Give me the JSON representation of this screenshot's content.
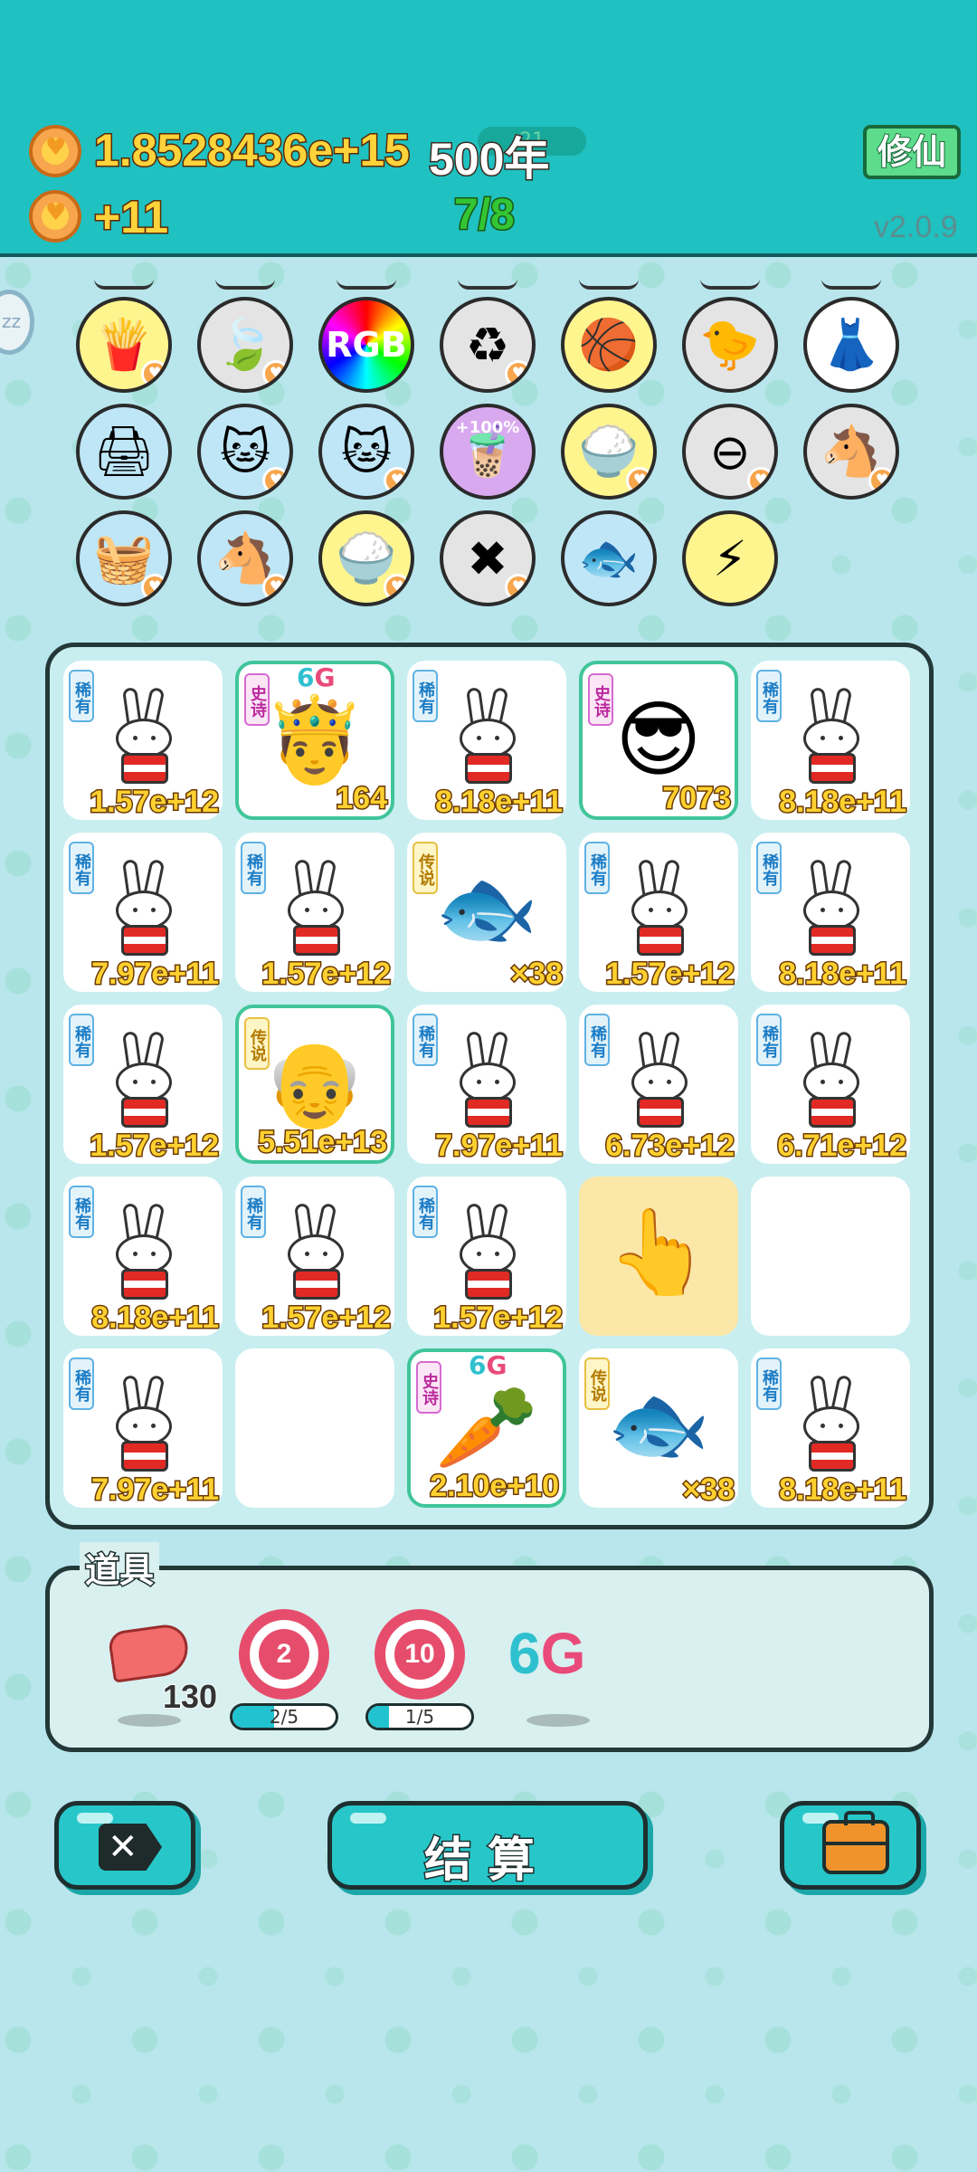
{
  "header": {
    "coins_total": "1.8528436e+15",
    "coins_rate": "+11",
    "years": "500年",
    "mid_pill": "21",
    "progress": "7/8",
    "mode_button": "修仙",
    "version": "v2.0.9",
    "side_badge": "zz"
  },
  "items": [
    {
      "name": "fries",
      "icon": "🍟",
      "bg": "#fff58f",
      "fav": true
    },
    {
      "name": "leaf",
      "icon": "🍃",
      "bg": "#e4e4e4",
      "fav": true
    },
    {
      "name": "rgb",
      "icon": "RGB",
      "bg": "#ffffff",
      "fav": false
    },
    {
      "name": "recycle",
      "icon": "♻",
      "bg": "#e4e4e4",
      "fav": true
    },
    {
      "name": "basketballs",
      "icon": "🏀",
      "bg": "#fff58f",
      "fav": false
    },
    {
      "name": "chick",
      "icon": "🐤",
      "bg": "#e4e4e4",
      "fav": false
    },
    {
      "name": "skirt",
      "icon": "👗",
      "bg": "#ffffff",
      "fav": false
    },
    {
      "name": "printer",
      "icon": "🖨",
      "bg": "#bfe6f7",
      "fav": false
    },
    {
      "name": "cat1",
      "icon": "🐱",
      "bg": "#bfe6f7",
      "fav": true
    },
    {
      "name": "cat2",
      "icon": "🐱",
      "bg": "#bfe6f7",
      "fav": true
    },
    {
      "name": "bubble-tea",
      "icon": "🧋",
      "bg": "#d9a9f0",
      "label": "+100%",
      "fav": false
    },
    {
      "name": "rice",
      "icon": "🍚",
      "bg": "#fff58f",
      "fav": true
    },
    {
      "name": "minus",
      "icon": "⊖",
      "bg": "#e4e4e4",
      "fav": true
    },
    {
      "name": "horses",
      "icon": "🐴",
      "bg": "#e4e4e4",
      "fav": true
    },
    {
      "name": "basket",
      "icon": "🧺",
      "bg": "#bfe6f7",
      "fav": true
    },
    {
      "name": "horses2",
      "icon": "🐴",
      "bg": "#bfe6f7",
      "fav": true
    },
    {
      "name": "rice2",
      "icon": "🍚",
      "bg": "#fff58f",
      "fav": true
    },
    {
      "name": "delete",
      "icon": "✖",
      "bg": "#e4e4e4",
      "fav": true
    },
    {
      "name": "fishbowl",
      "icon": "🐟",
      "bg": "#bfe6f7",
      "fav": false
    },
    {
      "name": "lightning",
      "icon": "⚡",
      "bg": "#fff58f",
      "fav": false
    }
  ],
  "board": [
    {
      "type": "bunny",
      "tag": "稀有",
      "tier": "rare",
      "value": "1.57e+12"
    },
    {
      "type": "king",
      "tag": "史诗",
      "tier": "epic",
      "value": "164",
      "badge": "6G"
    },
    {
      "type": "bunny",
      "tag": "稀有",
      "tier": "rare",
      "value": "8.18e+11"
    },
    {
      "type": "glasses",
      "tag": "史诗",
      "tier": "epic",
      "value": "7073"
    },
    {
      "type": "bunny",
      "tag": "稀有",
      "tier": "rare",
      "value": "8.18e+11"
    },
    {
      "type": "bunny",
      "tag": "稀有",
      "tier": "rare",
      "value": "7.97e+11"
    },
    {
      "type": "bunny",
      "tag": "稀有",
      "tier": "rare",
      "value": "1.57e+12"
    },
    {
      "type": "fish",
      "tag": "传说",
      "tier": "leg",
      "value": "×38"
    },
    {
      "type": "bunny",
      "tag": "稀有",
      "tier": "rare",
      "value": "1.57e+12"
    },
    {
      "type": "bunny",
      "tag": "稀有",
      "tier": "rare",
      "value": "8.18e+11"
    },
    {
      "type": "bunny",
      "tag": "稀有",
      "tier": "rare",
      "value": "1.57e+12"
    },
    {
      "type": "oldman",
      "tag": "传说",
      "tier": "leg",
      "value": "5.51e+13"
    },
    {
      "type": "bunny",
      "tag": "稀有",
      "tier": "rare",
      "value": "7.97e+11"
    },
    {
      "type": "bunny",
      "tag": "稀有",
      "tier": "rare",
      "value": "6.73e+12"
    },
    {
      "type": "bunny",
      "tag": "稀有",
      "tier": "rare",
      "value": "6.71e+12"
    },
    {
      "type": "bunny",
      "tag": "稀有",
      "tier": "rare",
      "value": "8.18e+11"
    },
    {
      "type": "bunny",
      "tag": "稀有",
      "tier": "rare",
      "value": "1.57e+12"
    },
    {
      "type": "bunny",
      "tag": "稀有",
      "tier": "rare",
      "value": "1.57e+12"
    },
    {
      "type": "hand"
    },
    {
      "type": "empty"
    },
    {
      "type": "bunny",
      "tag": "稀有",
      "tier": "rare",
      "value": "7.97e+11"
    },
    {
      "type": "empty"
    },
    {
      "type": "carrot",
      "tag": "史诗",
      "tier": "epic",
      "value": "2.10e+10",
      "badge": "6G"
    },
    {
      "type": "fish",
      "tag": "传说",
      "tier": "leg",
      "value": "×38"
    },
    {
      "type": "bunny",
      "tag": "稀有",
      "tier": "rare",
      "value": "8.18e+11"
    }
  ],
  "tools": {
    "title": "道具",
    "liver_count": "130",
    "target1_label": "2",
    "target1_progress": "2/5",
    "target1_fraction": 0.4,
    "target2_label": "10",
    "target2_progress": "1/5",
    "target2_fraction": 0.2,
    "sixg_label": "6G"
  },
  "bottom": {
    "settle_label": "结算"
  }
}
